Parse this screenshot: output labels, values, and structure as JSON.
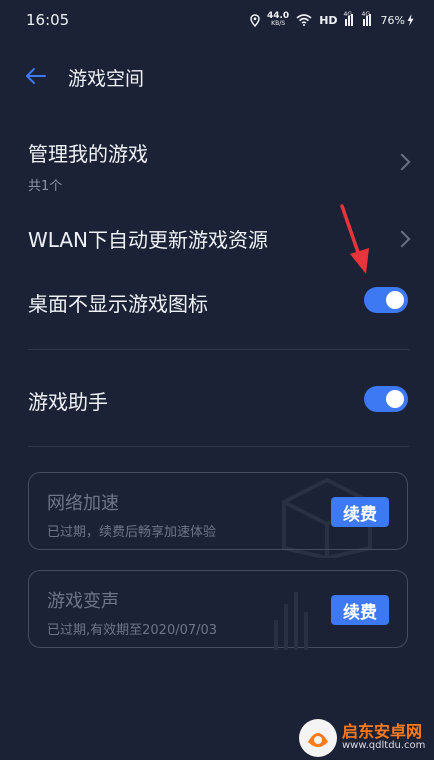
{
  "statusbar": {
    "time": "16:05",
    "speed_value": "44.0",
    "speed_unit": "KB/S",
    "hd_label": "HD",
    "network_1": "4G",
    "network_2": "4G",
    "battery": "76%"
  },
  "header": {
    "title": "游戏空间"
  },
  "manage": {
    "title": "管理我的游戏",
    "subtitle": "共1个"
  },
  "wlan": {
    "title": "WLAN下自动更新游戏资源"
  },
  "hide_icon": {
    "title": "桌面不显示游戏图标",
    "enabled": true
  },
  "assistant": {
    "title": "游戏助手",
    "enabled": true
  },
  "cards": [
    {
      "title": "网络加速",
      "subtitle": "已过期，续费后畅享加速体验",
      "button": "续费"
    },
    {
      "title": "游戏变声",
      "subtitle": "已过期,有效期至2020/07/03",
      "button": "续费"
    }
  ],
  "watermark": {
    "title": "启东安卓网",
    "url": "www.qdltdu.com"
  },
  "colors": {
    "background": "#1c2235",
    "accent": "#3d79f2",
    "annotation_arrow": "#e8343a"
  }
}
